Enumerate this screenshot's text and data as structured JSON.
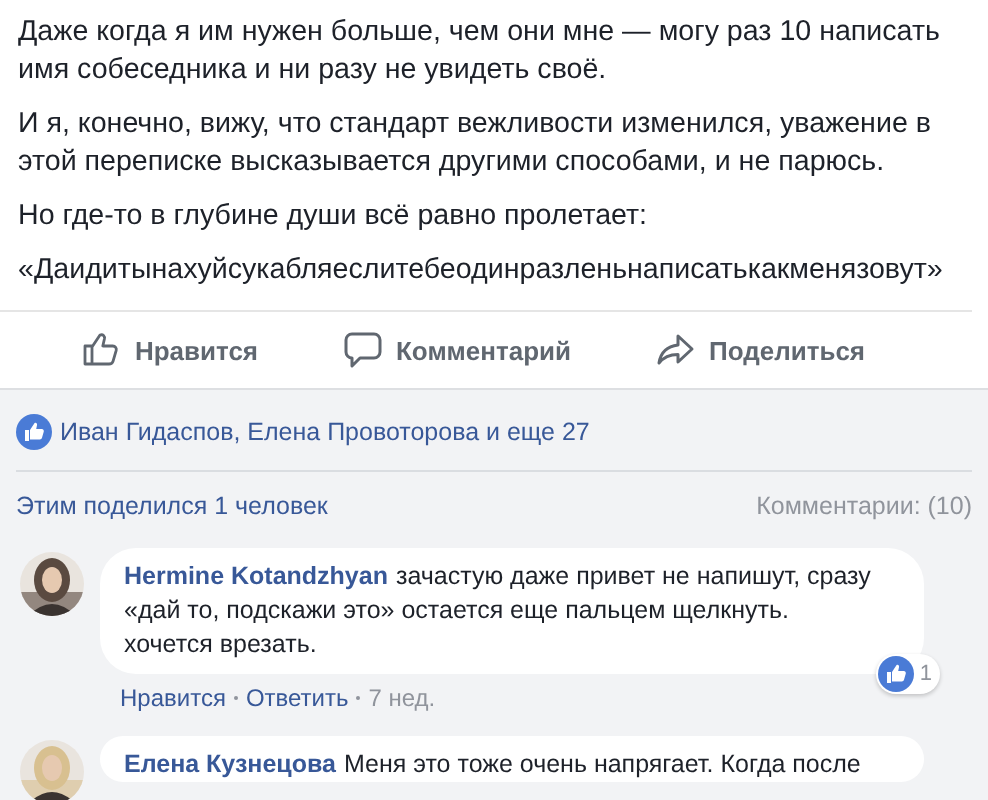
{
  "post": {
    "paragraphs": [
      "Даже когда я им нужен больше, чем они мне — могу раз 10 написать имя собеседника и ни разу не увидеть своё.",
      "И я, конечно, вижу, что стандарт вежливости изменился, уважение в этой переписке высказывается другими способами, и не парюсь.",
      "Но где-то в глубине души всё равно пролетает:",
      "«Даидитынахуйсукабляеслитебеодинразленьнаписатькакменязовут»"
    ]
  },
  "actions": [
    {
      "kind": "like",
      "label": "Нравится"
    },
    {
      "kind": "comment",
      "label": "Комментарий"
    },
    {
      "kind": "share",
      "label": "Поделиться"
    }
  ],
  "likes": {
    "text": "Иван Гидаспов, Елена Провоторова и еще 27"
  },
  "shares": {
    "text": "Этим поделился 1 человек"
  },
  "comments_count": "Комментарии: (10)",
  "comments": [
    {
      "author": "Hermine Kotandzhyan",
      "text": "зачастую даже привет не напишут, сразу\n«дай то, подскажи это» остается еще пальцем щелкнуть.\nхочется врезать.",
      "like_action": "Нравится",
      "reply_action": "Ответить",
      "time": "7 нед.",
      "reactions": "1"
    },
    {
      "author": "Елена Кузнецова",
      "text": "Меня это тоже очень напрягает. Когда после"
    }
  ]
}
